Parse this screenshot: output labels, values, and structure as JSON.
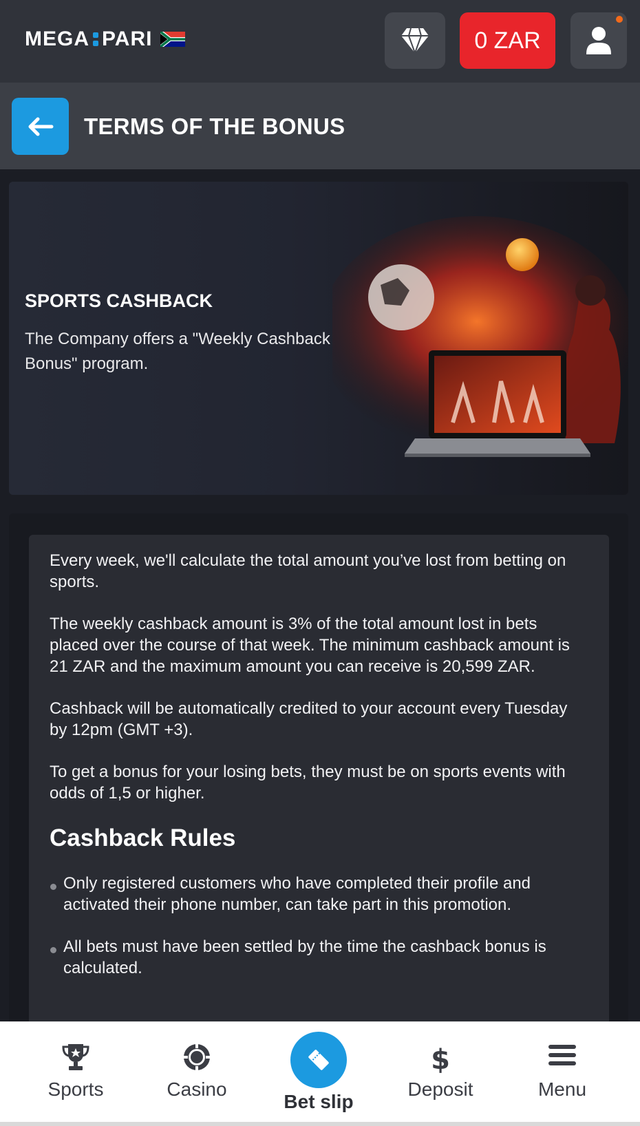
{
  "header": {
    "logo_left": "MEGA",
    "logo_right": "PARI",
    "balance": "0 ZAR"
  },
  "titlebar": {
    "title": "TERMS OF THE BONUS"
  },
  "banner": {
    "title": "SPORTS CASHBACK",
    "description": "The Company offers a \"Weekly Cashback Bonus\" program."
  },
  "content": {
    "paragraphs": [
      "Every week, we'll calculate the total amount you’ve lost from betting on sports.",
      "The weekly cashback amount is 3% of the total amount lost in bets placed over the course of that week. The minimum cashback amount is 21 ZAR and the maximum amount you can receive is 20,599 ZAR.",
      "Cashback will be automatically credited to your account every Tuesday by 12pm (GMT +3).",
      "To get a bonus for your losing bets, they must be on sports events with odds of 1,5 or higher."
    ],
    "rules_heading": "Cashback Rules",
    "rules": [
      "Only registered customers who have completed their profile and activated their phone number, can take part in this promotion.",
      "All bets must have been settled by the time the cashback bonus is calculated."
    ]
  },
  "bottom_nav": {
    "items": [
      {
        "label": "Sports",
        "icon": "trophy-icon"
      },
      {
        "label": "Casino",
        "icon": "casino-chip-icon"
      },
      {
        "label": "Bet slip",
        "icon": "ticket-icon"
      },
      {
        "label": "Deposit",
        "icon": "dollar-icon"
      },
      {
        "label": "Menu",
        "icon": "hamburger-icon"
      }
    ]
  },
  "colors": {
    "accent_blue": "#1c9ae0",
    "balance_red": "#e8252b",
    "notification_orange": "#f26a1b"
  }
}
